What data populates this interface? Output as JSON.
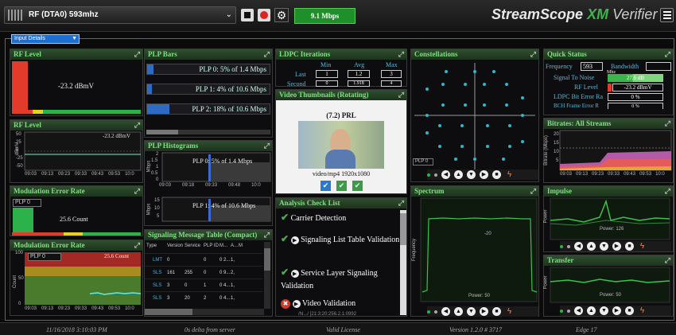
{
  "topbar": {
    "device": "RF (DTA0) 593mhz",
    "rate": "9.1 Mbps",
    "brand_main": "StreamScope",
    "brand_xm": "XM",
    "brand_verifier": "Verifier"
  },
  "input_details": {
    "label": "Input Details"
  },
  "rf_level": {
    "title": "RF Level",
    "value": "-23.2 dBmV"
  },
  "rf_level_chart": {
    "title": "RF Level",
    "ylabel": "dBmV",
    "readout": "-23.2 dBmV",
    "yticks": [
      "50",
      "25",
      "0",
      "-25",
      "-50"
    ],
    "xticks": [
      "09:03",
      "09:13",
      "09:23",
      "09:33",
      "09:43",
      "09:53",
      "10:0"
    ]
  },
  "mer": {
    "title": "Modulation Error Rate",
    "plp": "PLP 0",
    "value": "25.6 Count"
  },
  "mer_chart": {
    "title": "Modulation Error Rate",
    "plp": "PLP 0",
    "readout": "25.6 Count",
    "ylabel": "Count",
    "yticks": [
      "100",
      "50",
      "0"
    ],
    "xticks": [
      "09:03",
      "09:13",
      "09:23",
      "09:33",
      "09:43",
      "09:53",
      "10:0"
    ]
  },
  "plp_bars": {
    "title": "PLP Bars",
    "items": [
      {
        "label": "PLP 0: 5% of 1.4 Mbps",
        "fill": 0.05
      },
      {
        "label": "PLP 1: 4% of 10.6 Mbps",
        "fill": 0.04
      },
      {
        "label": "PLP 2: 18% of 10.6 Mbps",
        "fill": 0.18
      }
    ]
  },
  "plp_hist": {
    "title": "PLP Histograms",
    "h1": "PLP 0: 5% of 1.4 Mbps",
    "h2": "PLP 1: 4% of 10.6 Mbps",
    "ylabel": "Mbps",
    "yticks1": [
      "2",
      "1.5",
      "1",
      "0.5",
      "0"
    ],
    "yticks2": [
      "15",
      "10",
      "5"
    ],
    "xticks": [
      "09:03",
      "09:18",
      "09:33",
      "09:48",
      "10:0"
    ]
  },
  "signaling": {
    "title": "Signaling Message Table (Compact)",
    "headers": [
      "Type",
      "Version",
      "Service",
      "PLP ID",
      "M...",
      "A...",
      "M"
    ],
    "rows": [
      [
        "LMT",
        "0",
        "",
        "0",
        "0 2...",
        "1,"
      ],
      [
        "SLS",
        "161",
        "255",
        "0",
        "0 9...",
        "2,"
      ],
      [
        "SLS",
        "3",
        "0",
        "1",
        "0 4...",
        "1,"
      ],
      [
        "SLS",
        "3",
        "20",
        "2",
        "0 4...",
        "1,"
      ]
    ]
  },
  "ldpc": {
    "title": "LDPC Iterations",
    "cols": [
      "Min",
      "Avg",
      "Max"
    ],
    "row_last": "Last",
    "row_second": "Second",
    "last": [
      "1",
      "1.2",
      "3"
    ],
    "second": [
      "0",
      "1.918",
      "4"
    ]
  },
  "video": {
    "title": "Video Thumbnails (Rotating)",
    "caption": "(7.2) PRL",
    "format": "video/mp4 1920x1080"
  },
  "analysis": {
    "title": "Analysis Check List",
    "items": [
      "Carrier Detection",
      "Signaling List Table Validation",
      "Service Layer Signaling Validation",
      "Video Validation"
    ],
    "sub": "/hl.../ [21:3:20:256.2.1:0992"
  },
  "constellations": {
    "title": "Constellations",
    "plp": "PLP 0"
  },
  "spectrum": {
    "title": "Spectrum",
    "ylabel": "Frequency",
    "tick": "-20",
    "foot": "Power: 50"
  },
  "quick_status": {
    "title": "Quick Status",
    "freq_label": "Frequency",
    "freq_value": "593",
    "freq_unit": "Mhz",
    "bw_label": "Bandwidth",
    "snr_label": "Signal To Noise",
    "snr_value": "27.6 dB",
    "rf_label": "RF Level",
    "rf_value": "-23.2 dBmV",
    "ber_label": "LDPC Bit Error Ra",
    "ber_value": "0 %",
    "bch_label": "BCH Frame Error R",
    "bch_value": "0 %"
  },
  "bitrates": {
    "title": "Bitrates: All Streams",
    "ylabel": "Bitrate (Mbps)",
    "yticks": [
      "20",
      "15",
      "10",
      "5"
    ],
    "xticks": [
      "09:03",
      "09:13",
      "09:23",
      "09:33",
      "09:43",
      "09:53",
      "10:0"
    ]
  },
  "impulse": {
    "title": "Impulse",
    "ylabel": "Power",
    "foot": "Power: 126"
  },
  "transfer": {
    "title": "Transfer",
    "ylabel": "Power",
    "foot": "Power: 50"
  },
  "statusbar": {
    "datetime": "11/16/2018 3:10:03 PM",
    "delta": "0s delta from server",
    "license": "Valid License",
    "version": "Version 1.2.0 # 3717",
    "browser": "Edge 17"
  },
  "colors": {
    "accent_green": "#4caf50",
    "header_green": "#7fe07f",
    "bar_blue": "#2d6bc4",
    "rate_green": "#1f8f2a"
  }
}
